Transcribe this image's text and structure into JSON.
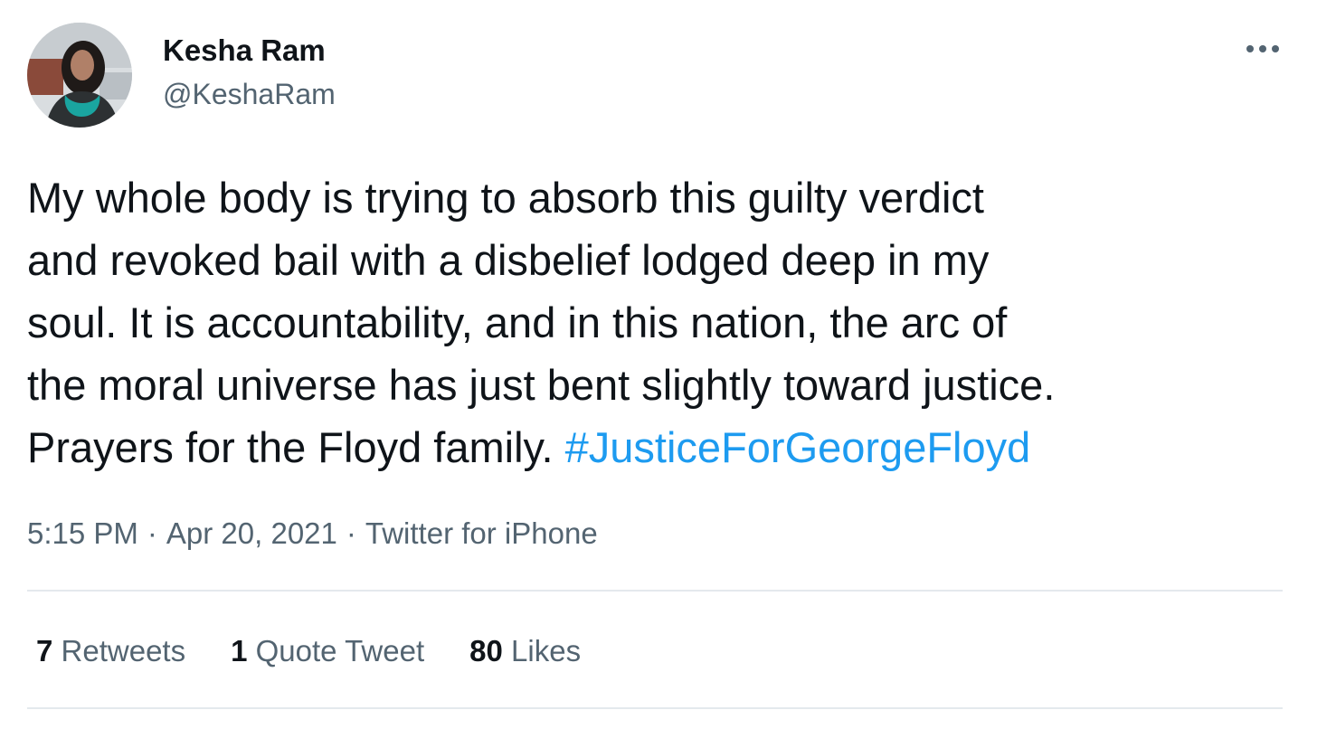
{
  "user": {
    "display_name": "Kesha Ram",
    "handle": "@KeshaRam"
  },
  "tweet": {
    "lines": [
      "My whole body is trying to absorb this guilty verdict",
      "and revoked bail with a disbelief lodged deep in my",
      "soul. It is accountability, and in this nation, the arc of",
      "the moral universe has just bent slightly toward justice."
    ],
    "last_line_text": "Prayers for the Floyd family.",
    "hashtag": "#JusticeForGeorgeFloyd"
  },
  "meta": {
    "time": "5:15 PM",
    "separator": "·",
    "date": "Apr 20, 2021",
    "source": "Twitter for iPhone"
  },
  "stats": {
    "retweets_count": "7",
    "retweets_label": "Retweets",
    "quotes_count": "1",
    "quotes_label": "Quote Tweet",
    "likes_count": "80",
    "likes_label": "Likes"
  },
  "icons": {
    "more": "more-horizontal-icon"
  },
  "colors": {
    "link": "#1d9bf0",
    "secondary_text": "#536471",
    "primary_text": "#0f1419",
    "divider": "#e4e9ed"
  }
}
